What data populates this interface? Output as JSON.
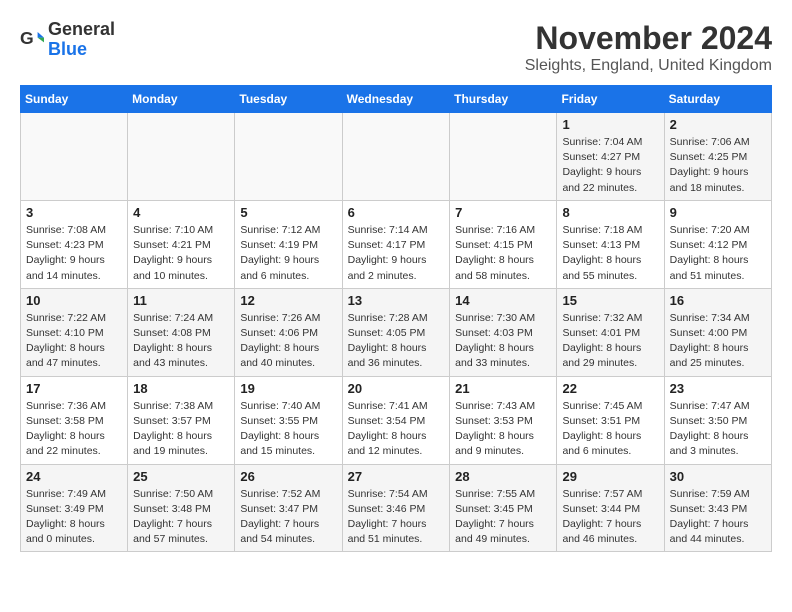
{
  "logo": {
    "text_general": "General",
    "text_blue": "Blue"
  },
  "header": {
    "month": "November 2024",
    "location": "Sleights, England, United Kingdom"
  },
  "weekdays": [
    "Sunday",
    "Monday",
    "Tuesday",
    "Wednesday",
    "Thursday",
    "Friday",
    "Saturday"
  ],
  "weeks": [
    [
      {
        "day": "",
        "info": ""
      },
      {
        "day": "",
        "info": ""
      },
      {
        "day": "",
        "info": ""
      },
      {
        "day": "",
        "info": ""
      },
      {
        "day": "",
        "info": ""
      },
      {
        "day": "1",
        "info": "Sunrise: 7:04 AM\nSunset: 4:27 PM\nDaylight: 9 hours\nand 22 minutes."
      },
      {
        "day": "2",
        "info": "Sunrise: 7:06 AM\nSunset: 4:25 PM\nDaylight: 9 hours\nand 18 minutes."
      }
    ],
    [
      {
        "day": "3",
        "info": "Sunrise: 7:08 AM\nSunset: 4:23 PM\nDaylight: 9 hours\nand 14 minutes."
      },
      {
        "day": "4",
        "info": "Sunrise: 7:10 AM\nSunset: 4:21 PM\nDaylight: 9 hours\nand 10 minutes."
      },
      {
        "day": "5",
        "info": "Sunrise: 7:12 AM\nSunset: 4:19 PM\nDaylight: 9 hours\nand 6 minutes."
      },
      {
        "day": "6",
        "info": "Sunrise: 7:14 AM\nSunset: 4:17 PM\nDaylight: 9 hours\nand 2 minutes."
      },
      {
        "day": "7",
        "info": "Sunrise: 7:16 AM\nSunset: 4:15 PM\nDaylight: 8 hours\nand 58 minutes."
      },
      {
        "day": "8",
        "info": "Sunrise: 7:18 AM\nSunset: 4:13 PM\nDaylight: 8 hours\nand 55 minutes."
      },
      {
        "day": "9",
        "info": "Sunrise: 7:20 AM\nSunset: 4:12 PM\nDaylight: 8 hours\nand 51 minutes."
      }
    ],
    [
      {
        "day": "10",
        "info": "Sunrise: 7:22 AM\nSunset: 4:10 PM\nDaylight: 8 hours\nand 47 minutes."
      },
      {
        "day": "11",
        "info": "Sunrise: 7:24 AM\nSunset: 4:08 PM\nDaylight: 8 hours\nand 43 minutes."
      },
      {
        "day": "12",
        "info": "Sunrise: 7:26 AM\nSunset: 4:06 PM\nDaylight: 8 hours\nand 40 minutes."
      },
      {
        "day": "13",
        "info": "Sunrise: 7:28 AM\nSunset: 4:05 PM\nDaylight: 8 hours\nand 36 minutes."
      },
      {
        "day": "14",
        "info": "Sunrise: 7:30 AM\nSunset: 4:03 PM\nDaylight: 8 hours\nand 33 minutes."
      },
      {
        "day": "15",
        "info": "Sunrise: 7:32 AM\nSunset: 4:01 PM\nDaylight: 8 hours\nand 29 minutes."
      },
      {
        "day": "16",
        "info": "Sunrise: 7:34 AM\nSunset: 4:00 PM\nDaylight: 8 hours\nand 25 minutes."
      }
    ],
    [
      {
        "day": "17",
        "info": "Sunrise: 7:36 AM\nSunset: 3:58 PM\nDaylight: 8 hours\nand 22 minutes."
      },
      {
        "day": "18",
        "info": "Sunrise: 7:38 AM\nSunset: 3:57 PM\nDaylight: 8 hours\nand 19 minutes."
      },
      {
        "day": "19",
        "info": "Sunrise: 7:40 AM\nSunset: 3:55 PM\nDaylight: 8 hours\nand 15 minutes."
      },
      {
        "day": "20",
        "info": "Sunrise: 7:41 AM\nSunset: 3:54 PM\nDaylight: 8 hours\nand 12 minutes."
      },
      {
        "day": "21",
        "info": "Sunrise: 7:43 AM\nSunset: 3:53 PM\nDaylight: 8 hours\nand 9 minutes."
      },
      {
        "day": "22",
        "info": "Sunrise: 7:45 AM\nSunset: 3:51 PM\nDaylight: 8 hours\nand 6 minutes."
      },
      {
        "day": "23",
        "info": "Sunrise: 7:47 AM\nSunset: 3:50 PM\nDaylight: 8 hours\nand 3 minutes."
      }
    ],
    [
      {
        "day": "24",
        "info": "Sunrise: 7:49 AM\nSunset: 3:49 PM\nDaylight: 8 hours\nand 0 minutes."
      },
      {
        "day": "25",
        "info": "Sunrise: 7:50 AM\nSunset: 3:48 PM\nDaylight: 7 hours\nand 57 minutes."
      },
      {
        "day": "26",
        "info": "Sunrise: 7:52 AM\nSunset: 3:47 PM\nDaylight: 7 hours\nand 54 minutes."
      },
      {
        "day": "27",
        "info": "Sunrise: 7:54 AM\nSunset: 3:46 PM\nDaylight: 7 hours\nand 51 minutes."
      },
      {
        "day": "28",
        "info": "Sunrise: 7:55 AM\nSunset: 3:45 PM\nDaylight: 7 hours\nand 49 minutes."
      },
      {
        "day": "29",
        "info": "Sunrise: 7:57 AM\nSunset: 3:44 PM\nDaylight: 7 hours\nand 46 minutes."
      },
      {
        "day": "30",
        "info": "Sunrise: 7:59 AM\nSunset: 3:43 PM\nDaylight: 7 hours\nand 44 minutes."
      }
    ]
  ]
}
